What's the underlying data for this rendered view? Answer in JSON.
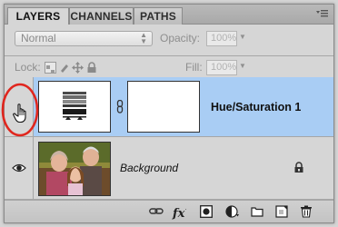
{
  "tabs": [
    {
      "label": "LAYERS",
      "active": true
    },
    {
      "label": "CHANNELS",
      "active": false
    },
    {
      "label": "PATHS",
      "active": false
    }
  ],
  "blend_mode": {
    "value": "Normal"
  },
  "opacity": {
    "label": "Opacity:",
    "value": "100%"
  },
  "lock": {
    "label": "Lock:"
  },
  "fill": {
    "label": "Fill:",
    "value": "100%"
  },
  "layers": [
    {
      "name": "Hue/Saturation 1",
      "selected": true,
      "visible": false,
      "type": "adjustment"
    },
    {
      "name": "Background",
      "selected": false,
      "visible": true,
      "type": "image",
      "locked": true
    }
  ],
  "bottom_icons": [
    "link-layers-icon",
    "fx-icon",
    "add-mask-icon",
    "new-adjustment-icon",
    "new-group-icon",
    "new-layer-icon",
    "trash-icon"
  ],
  "colors": {
    "selected_row": "#a9cdf4",
    "highlight_circle": "#e0261e"
  },
  "bottom_bar": {
    "fx_label": "fx"
  }
}
